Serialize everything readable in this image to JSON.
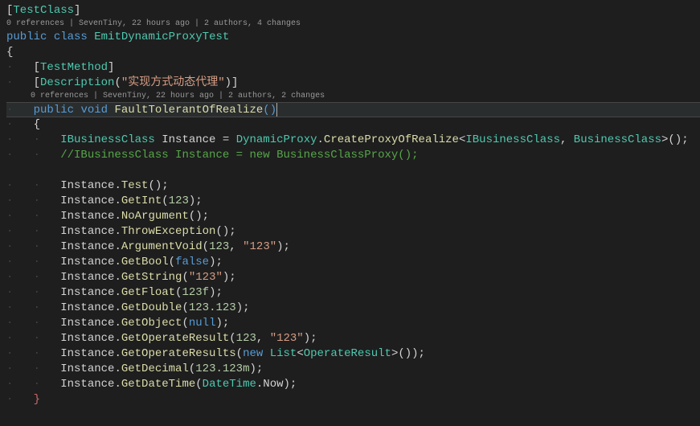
{
  "attr": {
    "testClass": "TestClass",
    "testMethod": "TestMethod",
    "description": "Description",
    "descArg": "\"实现方式动态代理\""
  },
  "codelens": {
    "class": "0 references | SevenTiny, 22 hours ago | 2 authors, 4 changes",
    "method": "0 references | SevenTiny, 22 hours ago | 2 authors, 2 changes"
  },
  "decl": {
    "public": "public",
    "class": "class",
    "void": "void",
    "className": "EmitDynamicProxyTest",
    "methodName": "FaultTolerantOfRealize"
  },
  "body": {
    "iface": "IBusinessClass",
    "inst": "Instance",
    "dynProxy": "DynamicProxy",
    "createProxy": "CreateProxyOfRealize",
    "bizClass": "BusinessClass",
    "commentLine": "//IBusinessClass Instance = new BusinessClassProxy();",
    "calls": {
      "test": "Test",
      "getInt": "GetInt",
      "getIntArg": "123",
      "noArg": "NoArgument",
      "throwEx": "ThrowException",
      "argVoid": "ArgumentVoid",
      "argVoidN": "123",
      "argVoidS": "\"123\"",
      "getBool": "GetBool",
      "false": "false",
      "getStr": "GetString",
      "getStrArg": "\"123\"",
      "getFloat": "GetFloat",
      "getFloatArg": "123f",
      "getDouble": "GetDouble",
      "getDoubleArg": "123.123",
      "getObj": "GetObject",
      "null": "null",
      "getOpRes": "GetOperateResult",
      "opResN": "123",
      "opResS": "\"123\"",
      "getOpResults": "GetOperateResults",
      "new": "new",
      "list": "List",
      "opResult": "OperateResult",
      "getDec": "GetDecimal",
      "getDecArg": "123.123m",
      "getDT": "GetDateTime",
      "dt": "DateTime",
      "now": "Now"
    }
  }
}
